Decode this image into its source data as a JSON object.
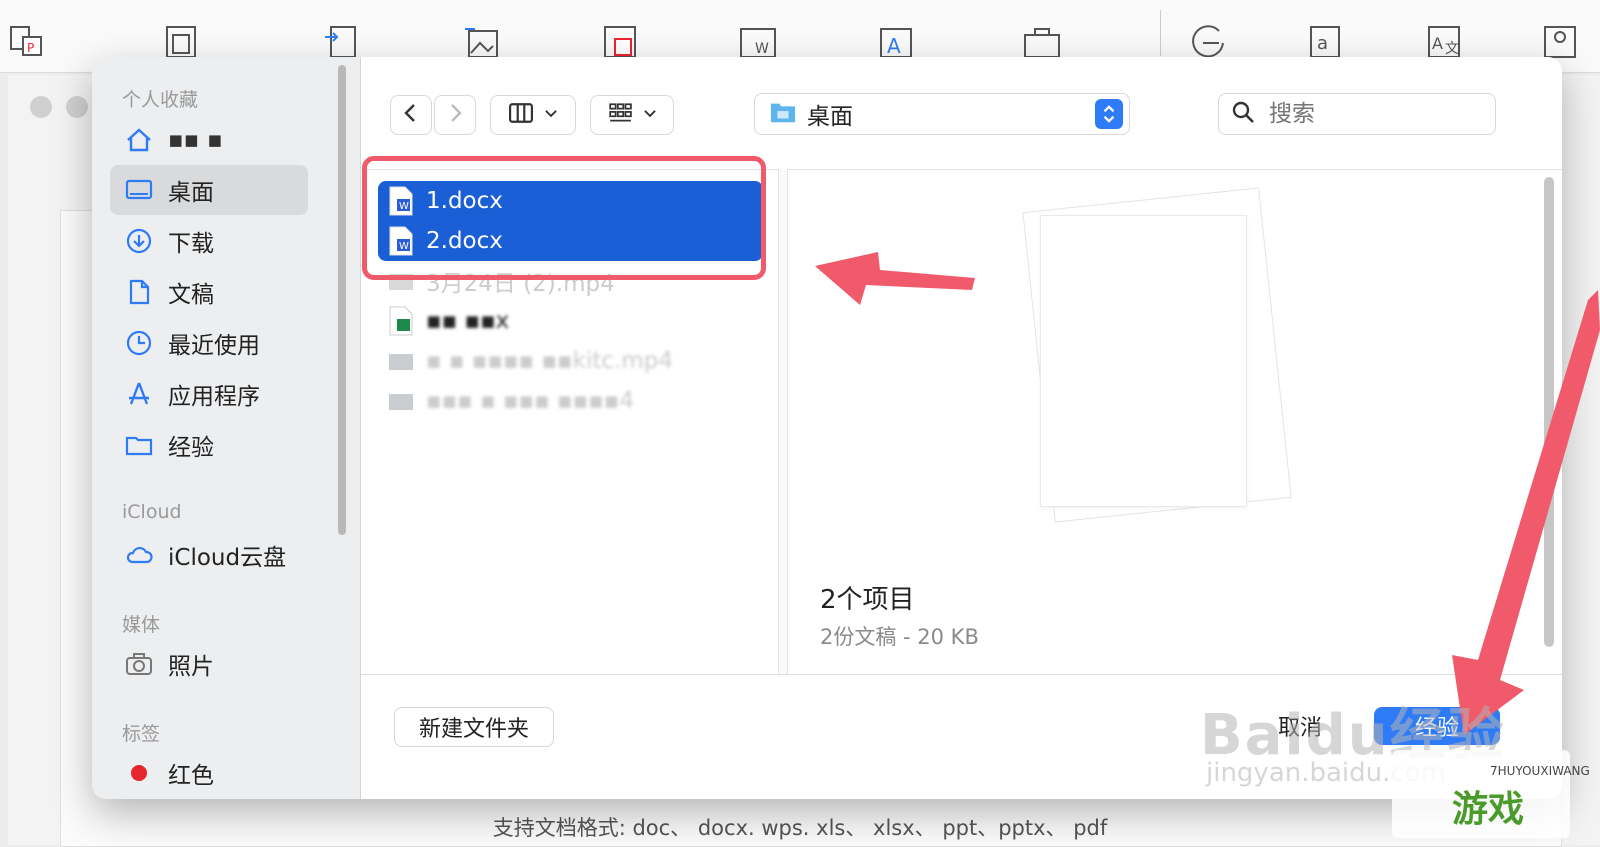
{
  "background_app": {
    "toolbar_icons": [
      "pdf-to-ppt-icon",
      "pdf-to-doc-icon",
      "pdf-convert-icon",
      "image-insert-icon",
      "image-to-pdf-icon",
      "image-to-word-icon",
      "text-icon",
      "toolbox-icon",
      "compress-icon",
      "ocr-icon",
      "translate-icon",
      "account-icon"
    ],
    "footer_text": "支持文档格式: doc、 docx. wps. xls、 xlsx、 ppt、pptx、 pdf"
  },
  "sidebar": {
    "favorites_header": "个人收藏",
    "favorites": [
      {
        "label": "▪▪ ▪",
        "icon": "home-icon"
      },
      {
        "label": "桌面",
        "icon": "desktop-icon",
        "selected": true
      },
      {
        "label": "下载",
        "icon": "download-icon"
      },
      {
        "label": "文稿",
        "icon": "document-icon"
      },
      {
        "label": "最近使用",
        "icon": "clock-icon"
      },
      {
        "label": "应用程序",
        "icon": "applications-icon"
      },
      {
        "label": "经验",
        "icon": "folder-icon"
      }
    ],
    "icloud_header": "iCloud",
    "icloud": [
      {
        "label": "iCloud云盘",
        "icon": "cloud-icon"
      }
    ],
    "media_header": "媒体",
    "media": [
      {
        "label": "照片",
        "icon": "camera-icon"
      }
    ],
    "tags_header": "标签",
    "tags": [
      {
        "label": "红色",
        "color": "#e8262d"
      }
    ]
  },
  "toolbar": {
    "location": "桌面",
    "search_placeholder": "搜索"
  },
  "files": [
    {
      "name": "1.docx",
      "type": "word",
      "selected": true
    },
    {
      "name": "2.docx",
      "type": "word",
      "selected": true
    },
    {
      "name": "3月24日 (2).mp4",
      "type": "video",
      "dim": true
    },
    {
      "name": "▪▪ ▪▪x",
      "type": "excel",
      "blurred": true
    },
    {
      "name": "▪ ▪ ▪▪▪▪  ▪▪kitc.mp4",
      "type": "video",
      "blurred": true
    },
    {
      "name": "▪▪▪ ▪ ▪▪▪ ▪▪▪▪4",
      "type": "video",
      "blurred": true
    }
  ],
  "preview": {
    "title": "2个项目",
    "subtitle": "2份文稿 - 20 KB"
  },
  "buttons": {
    "new_folder": "新建文件夹",
    "cancel": "取消",
    "open": "经验"
  },
  "watermark": {
    "text": "Baidu经验",
    "url": "jingyan.baidu.com",
    "logo_text": "游戏",
    "logo_small": "7HUYOUXIWANG"
  },
  "colors": {
    "accent": "#2f7bf5",
    "selection": "#1a5fd6",
    "annotation": "#f05a6a"
  }
}
